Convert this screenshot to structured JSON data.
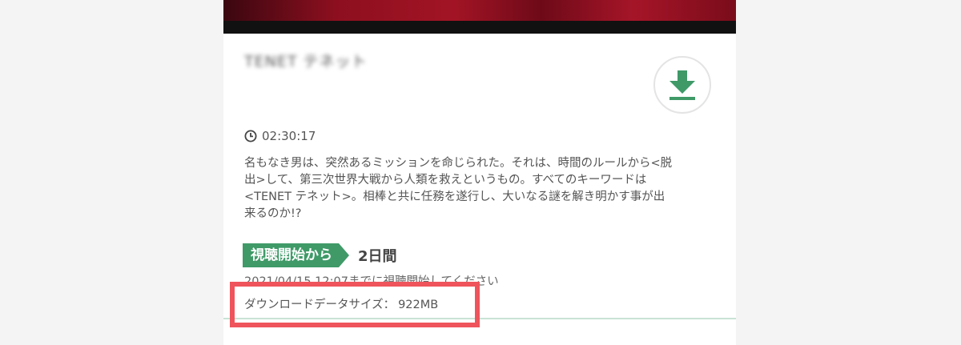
{
  "video": {
    "title": "TENET テネット",
    "duration": "02:30:17",
    "synopsis_lines": [
      "名もなき男は、突然あるミッションを命じられた。それは、時間のルールから<脱",
      "出>して、第三次世界大戦から人類を救えというもの。すべてのキーワードは",
      "<TENET テネット>。相棒と共に任務を遂行し、大いなる謎を解き明かす事が出",
      "来るのか!?"
    ]
  },
  "viewing_period": {
    "badge": "視聴開始から",
    "value": "2日間",
    "deadline": "2021/04/15 12:07までに視聴開始してください"
  },
  "download": {
    "size_label": "ダウンロードデータサイズ",
    "separator": "：",
    "size_value": "922MB"
  },
  "icons": {
    "duration": "clock-icon",
    "download": "download-icon"
  },
  "colors": {
    "accent_green": "#3f9a68",
    "highlight_red": "#ef545c"
  }
}
